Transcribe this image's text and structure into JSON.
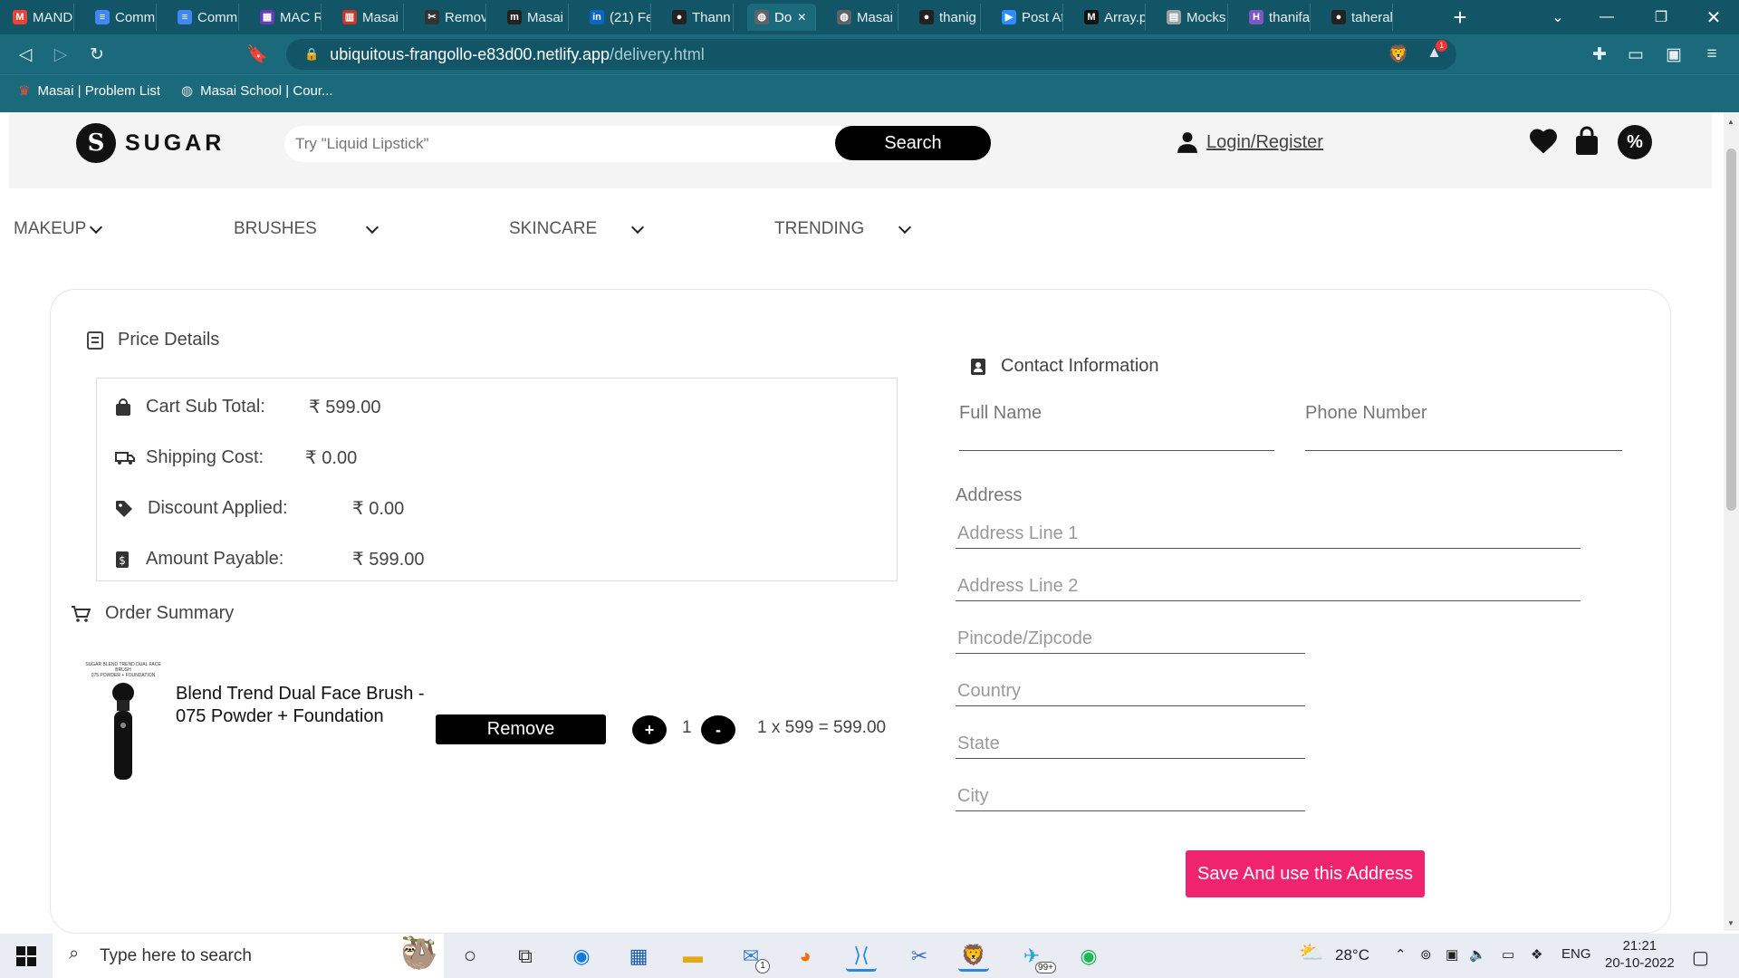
{
  "browser": {
    "tabs": [
      {
        "label": "MAND",
        "color": "#ea4335",
        "glyph": "M"
      },
      {
        "label": "Comm",
        "color": "#4285f4",
        "glyph": "≡"
      },
      {
        "label": "Comm",
        "color": "#4285f4",
        "glyph": "≡"
      },
      {
        "label": "MAC R",
        "color": "#673ab7",
        "glyph": "▦"
      },
      {
        "label": "Masai",
        "color": "#c0392b",
        "glyph": "▥"
      },
      {
        "label": "Remov",
        "color": "#333333",
        "glyph": "✂"
      },
      {
        "label": "Masai",
        "color": "#222222",
        "glyph": "m"
      },
      {
        "label": "(21) Fe",
        "color": "#0a66c2",
        "glyph": "in"
      },
      {
        "label": "Thann",
        "color": "#222222",
        "glyph": "●"
      },
      {
        "label": "Do",
        "color": "#5f6368",
        "glyph": "◍",
        "active": true
      },
      {
        "label": "Masai",
        "color": "#5f6368",
        "glyph": "◍"
      },
      {
        "label": "thanig",
        "color": "#222222",
        "glyph": "●"
      },
      {
        "label": "Post At",
        "color": "#2d8cff",
        "glyph": "▶"
      },
      {
        "label": "Array.p",
        "color": "#111111",
        "glyph": "M"
      },
      {
        "label": "Mocks",
        "color": "#9aa0a6",
        "glyph": "▤"
      },
      {
        "label": "thanifa",
        "color": "#7e57c2",
        "glyph": "H"
      },
      {
        "label": "taheral",
        "color": "#222222",
        "glyph": "●"
      }
    ],
    "url_host": "ubiquitous-frangollo-e83d00.netlify.app",
    "url_path": "/delivery.html",
    "bookmarks": [
      "Masai | Problem List",
      "Masai School | Cour..."
    ],
    "alert_count": "1"
  },
  "site": {
    "logo_letter": "S",
    "logo_text": "SUGAR",
    "search_placeholder": "Try \"Liquid Lipstick\"",
    "search_button": "Search",
    "login_label": "Login/Register",
    "offer_glyph": "%",
    "nav": [
      "MAKEUP",
      "BRUSHES",
      "SKINCARE",
      "TRENDING"
    ]
  },
  "price_details": {
    "title": "Price Details",
    "rows": [
      {
        "label": "Cart Sub Total:",
        "value": "₹ 599.00"
      },
      {
        "label": "Shipping Cost:",
        "value": "₹ 0.00"
      },
      {
        "label": "Discount Applied:",
        "value": "₹ 0.00"
      },
      {
        "label": "Amount Payable:",
        "value": "₹ 599.00"
      }
    ]
  },
  "order_summary": {
    "title": "Order Summary",
    "item": {
      "name_line1": "Blend Trend Dual Face Brush -",
      "name_line2": "075 Powder + Foundation",
      "image_caption_1": "SUGAR BLEND TREND DUAL FACE BRUSH",
      "image_caption_2": "075 POWDER + FOUNDATION",
      "remove_label": "Remove",
      "plus": "+",
      "quantity": "1",
      "minus": "-",
      "line_total": "1 x 599 = 599.00"
    }
  },
  "contact": {
    "title": "Contact Information",
    "full_name_label": "Full Name",
    "phone_label": "Phone Number",
    "address_label": "Address",
    "placeholders": {
      "line1": "Address Line 1",
      "line2": "Address Line 2",
      "pincode": "Pincode/Zipcode",
      "country": "Country",
      "state": "State",
      "city": "City"
    },
    "save_button": "Save And use this Address"
  },
  "taskbar": {
    "search_placeholder": "Type here to search",
    "mail_badge": "1",
    "telegram_badge": "99+",
    "weather": "28°C",
    "language": "ENG",
    "time": "21:21",
    "date": "20-10-2022"
  },
  "colors": {
    "browser_dark": "#115567",
    "browser_mid": "#1b6a7c",
    "accent_pink": "#f0236f"
  }
}
